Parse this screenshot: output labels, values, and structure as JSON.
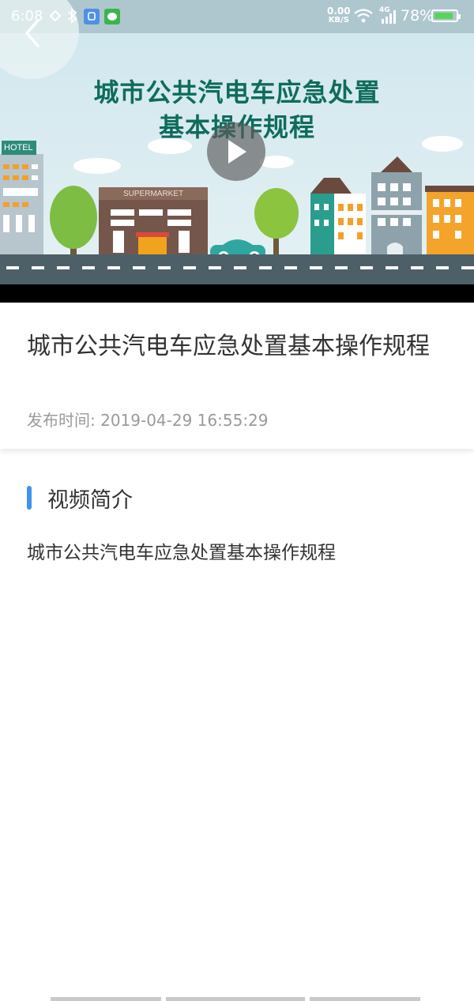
{
  "status_bar": {
    "time": "6:08",
    "network_speed": "0.00",
    "network_unit": "KB/S",
    "signal_type": "4G",
    "battery_percent": "78%"
  },
  "video": {
    "title_line1": "城市公共汽电车应急处置",
    "title_line2": "基本操作规程",
    "hotel_sign": "HOTEL",
    "supermarket_sign": "SUPERMARKET"
  },
  "article": {
    "title": "城市公共汽电车应急处置基本操作规程",
    "publish_time": "发布时间: 2019-04-29 16:55:29"
  },
  "intro": {
    "header": "视频简介",
    "description": "城市公共汽电车应急处置基本操作规程"
  },
  "colors": {
    "accent": "#3d94ea",
    "title_green": "#0f6c5c"
  }
}
